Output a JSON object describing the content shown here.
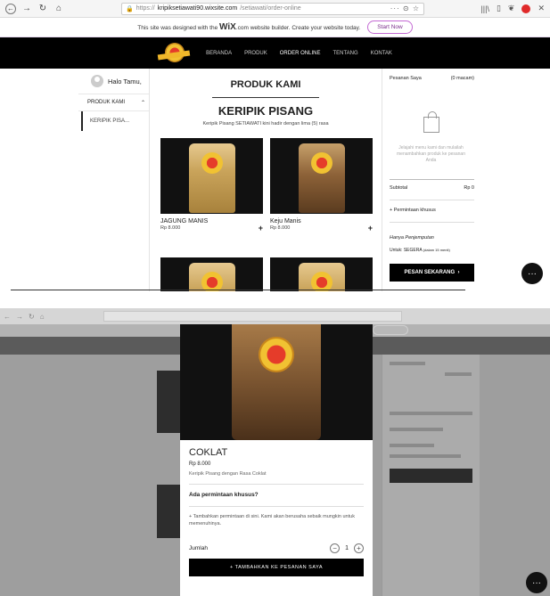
{
  "browser": {
    "url_prefix": "https://",
    "url_domain": "kripiksetiawati90.wixsite.com",
    "url_path": "/setiawati/order-online",
    "url_end": "··· ⊙ ☆"
  },
  "wix_banner": {
    "text_before": "This site was designed with the",
    "logo": "WiX",
    "text_after": ".com website builder. Create your website today.",
    "button": "Start Now"
  },
  "nav": {
    "items": [
      "BERANDA",
      "PRODUK",
      "ORDER ONLINE",
      "TENTANG",
      "KONTAK"
    ]
  },
  "left": {
    "greeting": "Halo Tamu,",
    "section": "PRODUK KAMI",
    "subitem": "KERIPIK PISA..."
  },
  "main": {
    "heading": "PRODUK KAMI",
    "category_title": "KERIPIK PISANG",
    "category_desc": "Keripik Pisang SETIAWATI kini hadir dengan lima (5) rasa",
    "products": [
      {
        "name": "JAGUNG MANIS",
        "price": "Rp 8.000"
      },
      {
        "name": "Keju Manis",
        "price": "Rp 8.000"
      }
    ]
  },
  "cart": {
    "title": "Pesanan Saya",
    "count": "(0 macam)",
    "empty_text": "Jelajahi menu kami dan mulailah menambahkan produk ke pesanan Anda",
    "subtotal_label": "Subtotal",
    "subtotal_value": "Rp 0",
    "special_request": "+ Permintaan khusus",
    "pickup": "Hanya Penjemputan",
    "when": "Untuk: SEGERA",
    "when_note": "(dalam 15 menit)",
    "checkout": "PESAN SEKARANG"
  },
  "modal": {
    "name": "COKLAT",
    "price": "Rp 8.000",
    "description": "Keripik Pisang dengan Rasa Coklat",
    "question": "Ada permintaan khusus?",
    "add_request": "+ Tambahkan permintaan di sini. Kami akan berusaha sebaik mungkin untuk memenuhinya.",
    "qty_label": "Jumlah",
    "qty_value": "1",
    "add_button": "+ TAMBAHKAN KE PESANAN SAYA"
  }
}
